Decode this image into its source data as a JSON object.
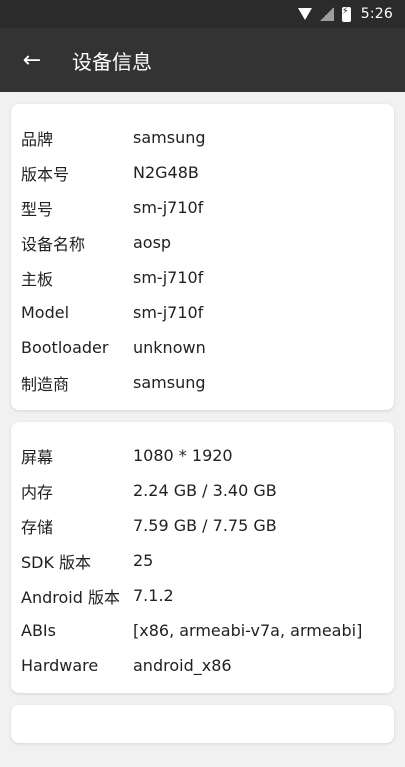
{
  "status_bar": {
    "time": "5:26",
    "icons": [
      "wifi-icon",
      "signal-icon",
      "battery-charging-icon"
    ]
  },
  "app_bar": {
    "title": "设备信息",
    "back_icon": "arrow-left-icon"
  },
  "sections": [
    {
      "items": [
        {
          "key": "品牌",
          "value": "samsung"
        },
        {
          "key": "版本号",
          "value": "N2G48B"
        },
        {
          "key": "型号",
          "value": "sm-j710f"
        },
        {
          "key": "设备名称",
          "value": "aosp"
        },
        {
          "key": "主板",
          "value": "sm-j710f"
        },
        {
          "key": "Model",
          "value": "sm-j710f"
        },
        {
          "key": "Bootloader",
          "value": "unknown"
        },
        {
          "key": "制造商",
          "value": "samsung"
        }
      ]
    },
    {
      "items": [
        {
          "key": "屏幕",
          "value": "1080 * 1920"
        },
        {
          "key": "内存",
          "value": "2.24 GB / 3.40 GB"
        },
        {
          "key": "存储",
          "value": "7.59 GB / 7.75 GB"
        },
        {
          "key": "SDK 版本",
          "value": "25"
        },
        {
          "key": "Android 版本",
          "value": "7.1.2"
        },
        {
          "key": "ABIs",
          "value": "[x86, armeabi-v7a, armeabi]"
        },
        {
          "key": "Hardware",
          "value": "android_x86"
        }
      ]
    }
  ]
}
